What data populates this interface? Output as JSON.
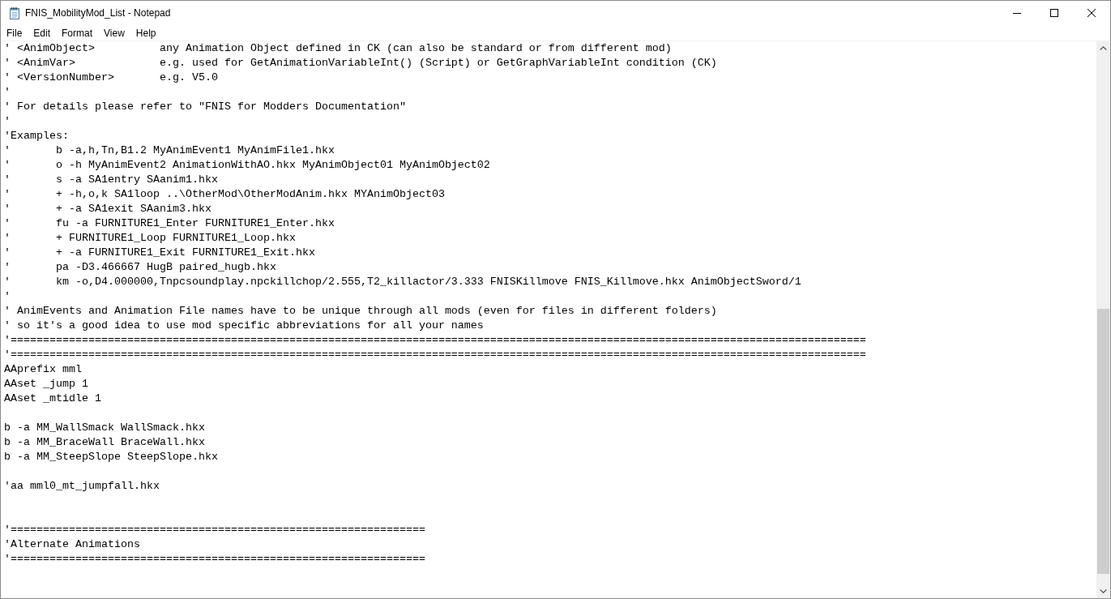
{
  "window": {
    "title": "FNIS_MobilityMod_List - Notepad"
  },
  "menu_bar": [
    {
      "label": "File"
    },
    {
      "label": "Edit"
    },
    {
      "label": "Format"
    },
    {
      "label": "View"
    },
    {
      "label": "Help"
    }
  ],
  "editor": {
    "lines": [
      {
        "kind": "text",
        "text": "' <AnimObject>          any Animation Object defined in CK (can also be standard or from different mod)"
      },
      {
        "kind": "text",
        "text": "' <AnimVar>             e.g. used for GetAnimationVariableInt() (Script) or GetGraphVariableInt condition (CK)"
      },
      {
        "kind": "text",
        "text": "' <VersionNumber>       e.g. V5.0"
      },
      {
        "kind": "text",
        "text": "'"
      },
      {
        "kind": "text",
        "text": "' For details please refer to \"FNIS for Modders Documentation\""
      },
      {
        "kind": "text",
        "text": "'"
      },
      {
        "kind": "text",
        "text": "'Examples:"
      },
      {
        "kind": "text",
        "text": "'       b -a,h,Tn,B1.2 MyAnimEvent1 MyAnimFile1.hkx"
      },
      {
        "kind": "text",
        "text": "'       o -h MyAnimEvent2 AnimationWithAO.hkx MyAnimObject01 MyAnimObject02"
      },
      {
        "kind": "text",
        "text": "'       s -a SA1entry SAanim1.hkx"
      },
      {
        "kind": "text",
        "text": "'       + -h,o,k SA1loop ..\\OtherMod\\OtherModAnim.hkx MYAnimObject03"
      },
      {
        "kind": "text",
        "text": "'       + -a SA1exit SAanim3.hkx"
      },
      {
        "kind": "text",
        "text": "'       fu -a FURNITURE1_Enter FURNITURE1_Enter.hkx"
      },
      {
        "kind": "text",
        "text": "'       + FURNITURE1_Loop FURNITURE1_Loop.hkx"
      },
      {
        "kind": "text",
        "text": "'       + -a FURNITURE1_Exit FURNITURE1_Exit.hkx"
      },
      {
        "kind": "text",
        "text": "'       pa -D3.466667 HugB paired_hugb.hkx"
      },
      {
        "kind": "text",
        "text": "'       km -o,D4.000000,Tnpcsoundplay.npckillchop/2.555,T2_killactor/3.333 FNISKillmove FNIS_Killmove.hkx AnimObjectSword/1"
      },
      {
        "kind": "text",
        "text": "'"
      },
      {
        "kind": "text",
        "text": "' AnimEvents and Animation File names have to be unique through all mods (even for files in different folders)"
      },
      {
        "kind": "text",
        "text": "' so it's a good idea to use mod specific abbreviations for all your names"
      },
      {
        "kind": "text",
        "text": "'===================================================================================================================================="
      },
      {
        "kind": "text",
        "text": "'===================================================================================================================================="
      },
      {
        "kind": "text",
        "text": "AAprefix mml"
      },
      {
        "kind": "text",
        "text": "AAset _jump 1"
      },
      {
        "kind": "text",
        "text": "AAset _mtidle 1"
      },
      {
        "kind": "blank"
      },
      {
        "kind": "text",
        "text": "b -a MM_WallSmack WallSmack.hkx"
      },
      {
        "kind": "text",
        "text": "b -a MM_BraceWall BraceWall.hkx"
      },
      {
        "kind": "text",
        "text": "b -a MM_SteepSlope SteepSlope.hkx"
      },
      {
        "kind": "blank"
      },
      {
        "kind": "text",
        "text": "'aa mml0_mt_jumpfall.hkx"
      },
      {
        "kind": "blank"
      },
      {
        "kind": "blank"
      },
      {
        "kind": "text",
        "text": "'================================================================"
      },
      {
        "kind": "text",
        "text": "'Alternate Animations"
      },
      {
        "kind": "text",
        "text": "'================================================================"
      }
    ]
  }
}
